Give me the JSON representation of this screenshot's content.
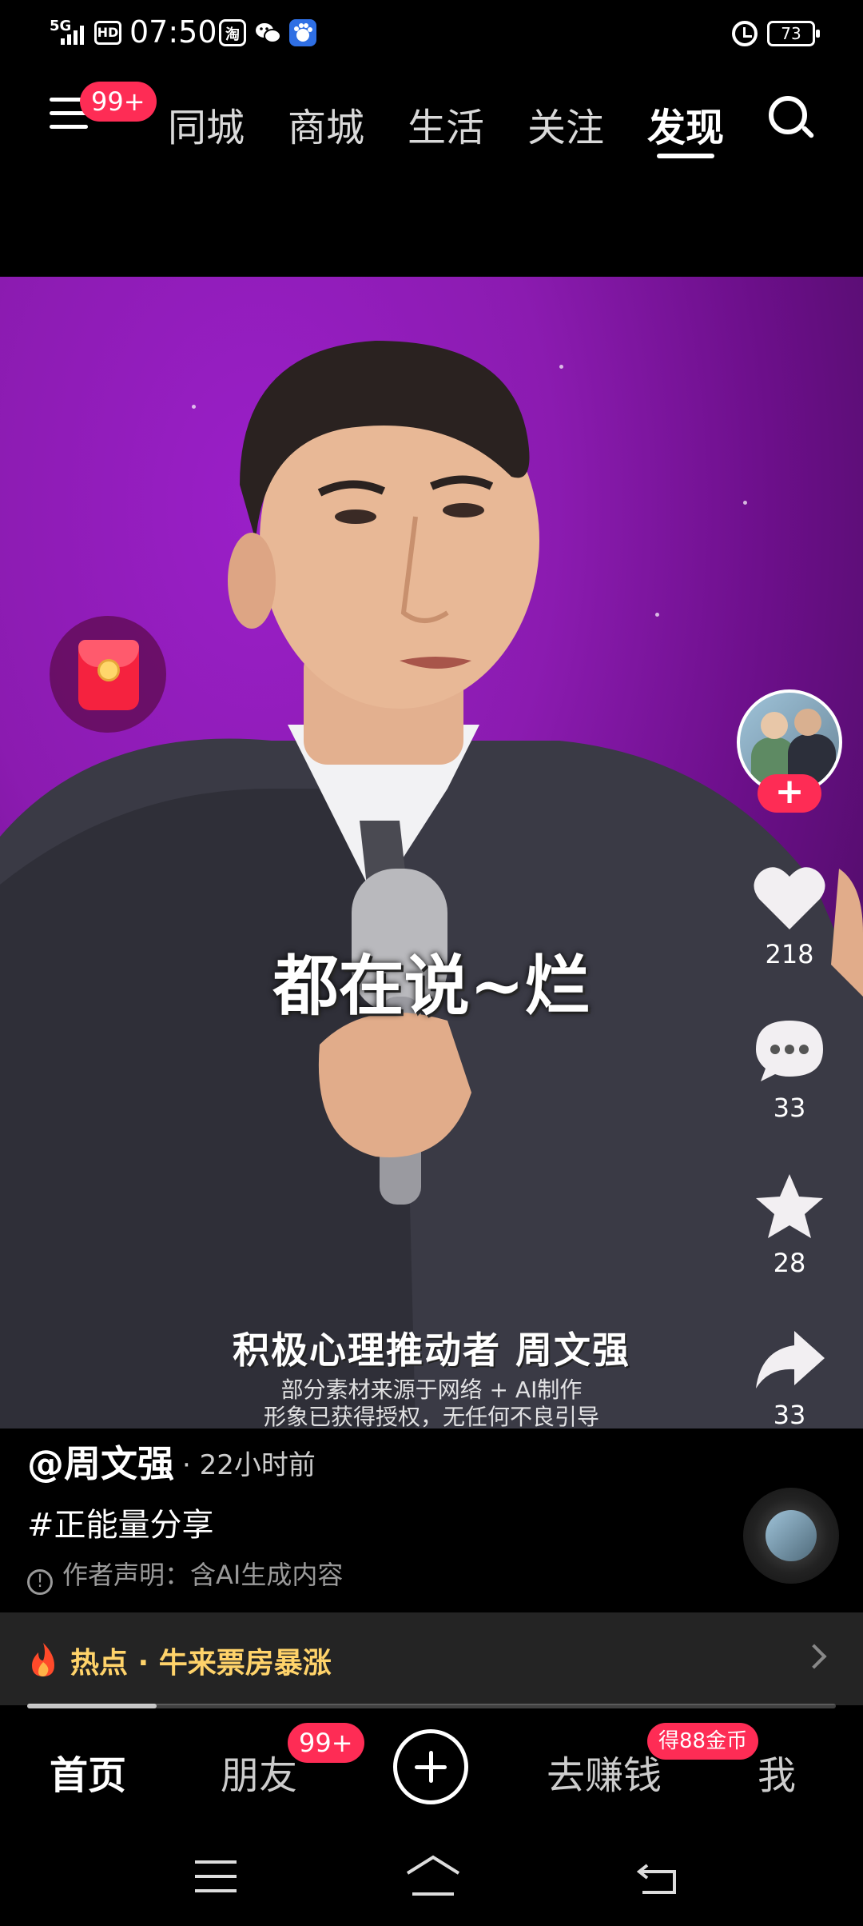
{
  "status_bar": {
    "network": "5G",
    "hd": "HD",
    "time": "07:50",
    "app_icons": [
      "taobao-icon",
      "wechat-icon",
      "baidu-icon"
    ],
    "taobao_label": "淘",
    "battery": "73"
  },
  "top_nav": {
    "menu_badge": "99+",
    "tabs": [
      {
        "label": "同城",
        "active": false
      },
      {
        "label": "商城",
        "active": false
      },
      {
        "label": "生活",
        "active": false
      },
      {
        "label": "关注",
        "active": false
      },
      {
        "label": "发现",
        "active": true
      }
    ]
  },
  "video": {
    "subtitle": "都在说~烂",
    "caption_name": "积极心理推动者 周文强",
    "disclaimer_line1": "部分素材来源于网络 + AI制作",
    "disclaimer_line2": "形象已获得授权，无任何不良引导"
  },
  "actions": {
    "follow": "+",
    "likes": "218",
    "comments": "33",
    "favorites": "28",
    "shares": "33"
  },
  "info": {
    "author": "@周文强",
    "time_ago": "· 22小时前",
    "hashtag": "#正能量分享",
    "notice": "作者声明：含AI生成内容",
    "notice_icon": "!"
  },
  "hot_topic": {
    "text": "热点 · 牛来票房暴涨",
    "progress": 0.16
  },
  "bottom_nav": {
    "home": "首页",
    "friends": "朋友",
    "friends_badge": "99+",
    "earn": "去赚钱",
    "earn_badge": "得88金币",
    "me": "我"
  },
  "colors": {
    "accent": "#fe2c55",
    "hot_text": "#ffd36a",
    "video_bg": "#8b1bb0"
  }
}
